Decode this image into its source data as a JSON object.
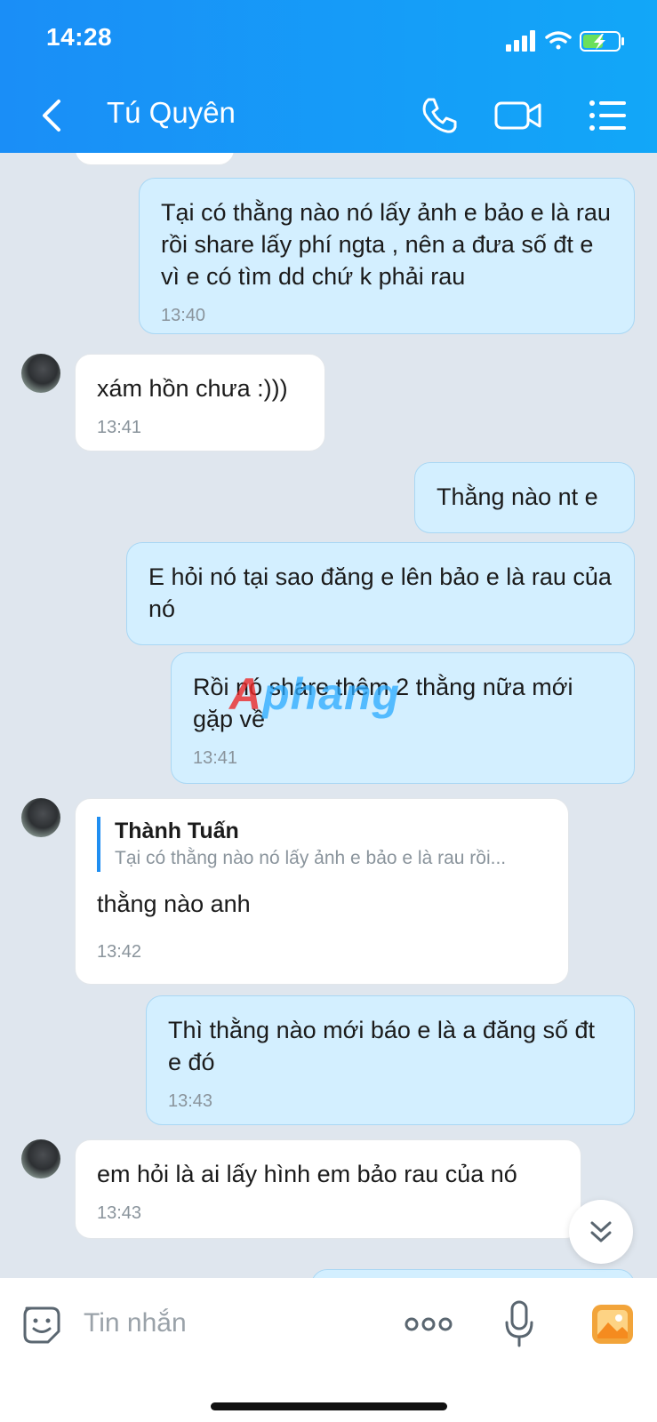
{
  "status_bar": {
    "time": "14:28"
  },
  "header": {
    "contact_name": "Tú Quyên"
  },
  "messages": [
    {
      "side": "out",
      "text": "Tại có thằng nào nó lấy ảnh e bảo e là rau rồi share lấy phí ngta , nên a đưa số đt e vì e có tìm dd chứ k phải rau",
      "time": "13:40"
    },
    {
      "side": "in",
      "text": "xám hồn chưa :)))",
      "time": "13:41"
    },
    {
      "side": "out",
      "text": "Thằng nào nt e"
    },
    {
      "side": "out",
      "text": "E hỏi nó tại sao đăng e lên bảo e là rau của nó"
    },
    {
      "side": "out",
      "text": "Rồi nó share thêm 2 thằng nữa mới gặp về",
      "time": "13:41"
    },
    {
      "side": "in",
      "quote_name": "Thành Tuấn",
      "quote_text": "Tại có thằng nào nó lấy ảnh e bảo e là rau rồi...",
      "text": "thằng nào anh",
      "time": "13:42"
    },
    {
      "side": "out",
      "text": "Thì thằng nào mới báo e là a đăng số đt e đó",
      "time": "13:43"
    },
    {
      "side": "in",
      "text": "em hỏi là ai lấy hình em bảo rau của nó",
      "time": "13:43"
    }
  ],
  "watermark": {
    "part1": "A",
    "part2": "phang"
  },
  "input": {
    "placeholder": "Tin nhắn"
  },
  "icons": {
    "back": "chevron-left-icon",
    "call": "phone-icon",
    "video": "video-camera-icon",
    "menu": "list-menu-icon",
    "sticker": "sticker-face-icon",
    "more": "more-dots-icon",
    "mic": "microphone-icon",
    "gallery": "image-gallery-icon",
    "scroll": "double-chevron-down-icon"
  },
  "colors": {
    "header": "#1a8ef7",
    "outgoing_bubble": "#d3efff",
    "incoming_bubble": "#ffffff",
    "background": "#dfe6ee",
    "accent": "#1f8ef1"
  }
}
